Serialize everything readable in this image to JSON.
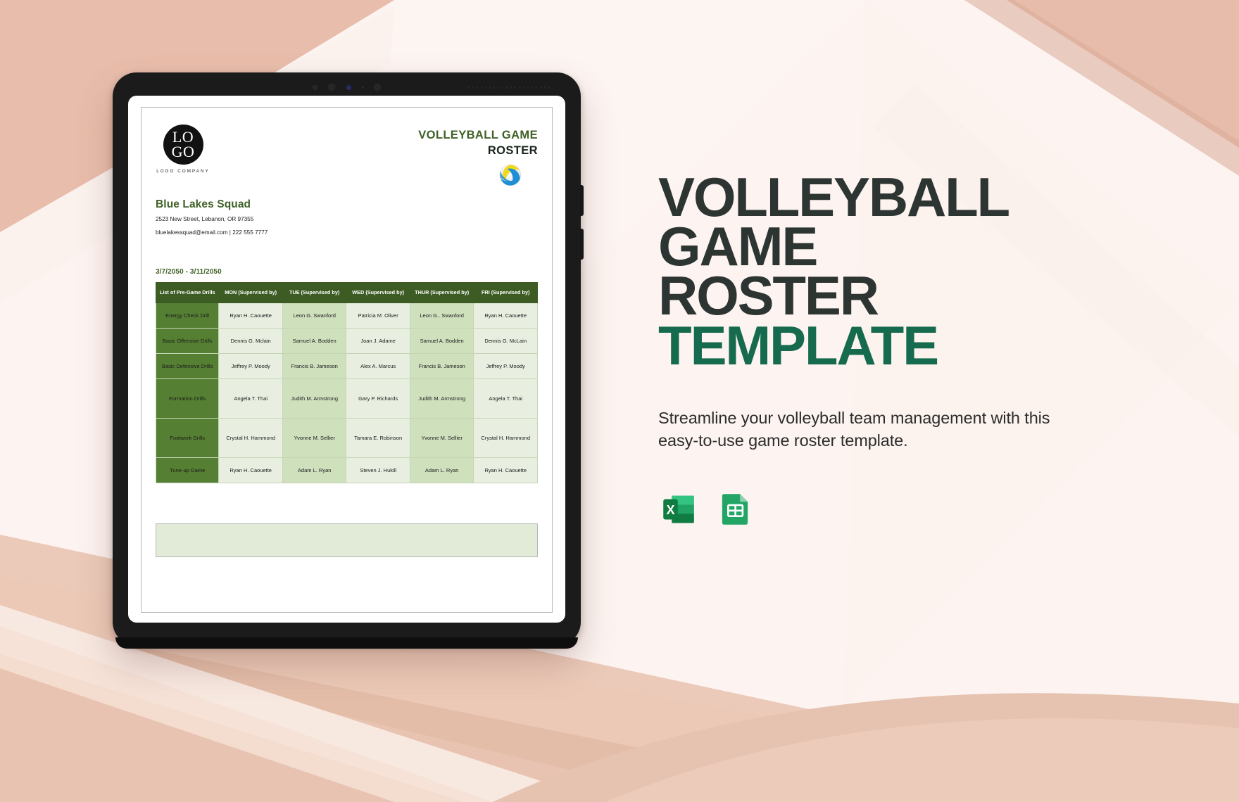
{
  "promo": {
    "title_line1": "VOLLEYBALL",
    "title_line2": "GAME",
    "title_line3": "ROSTER",
    "title_line4": "TEMPLATE",
    "subtitle": "Streamline your volleyball team management with this easy-to-use game roster template.",
    "file_formats": [
      {
        "name": "excel-icon",
        "label": "X"
      },
      {
        "name": "google-sheets-icon",
        "label": ""
      }
    ],
    "colors": {
      "heading_dark": "#2d3533",
      "heading_accent": "#166b4f"
    }
  },
  "document": {
    "logo": {
      "line1": "LO",
      "line2": "GO",
      "caption": "LOGO COMPANY"
    },
    "title_line1": "VOLLEYBALL GAME",
    "title_line2": "ROSTER",
    "ball_icon": "volleyball-icon",
    "team_name": "Blue Lakes Squad",
    "address": "2523 New Street, Lebanon, OR 97355",
    "contact": "bluelakessquad@email.com  |  222 555 7777",
    "date_range": "3/7/2050 - 3/11/2050",
    "colors": {
      "header_green": "#3d5c24",
      "drill_green": "#558033",
      "cell_light": "#e8efe0",
      "cell_dark": "#cfe0bd",
      "title_green": "#3f6127"
    },
    "table": {
      "columns": [
        "List of Pre-Game Drills",
        "MON (Supervised by)",
        "TUE (Supervised by)",
        "WED (Supervised by)",
        "THUR (Supervised by)",
        "FRI (Supervised by)"
      ],
      "rows": [
        {
          "drill": "Energy Check Drill",
          "mon": "Ryan H. Caouette",
          "tue": "Leon G. Swanford",
          "wed": "Patricia M. Oliver",
          "thur": "Leon G.. Swanford",
          "fri": "Ryan H. Caouette"
        },
        {
          "drill": "Basic Offensive Drills",
          "mon": "Dennis G. Mclain",
          "tue": "Samuel A. Bodden",
          "wed": "Joan J. Adame",
          "thur": "Samuel A. Bodden",
          "fri": "Dennis G. McLain"
        },
        {
          "drill": "Basic Defensive Drills",
          "mon": "Jeffrey P. Moody",
          "tue": "Francis B. Jameson",
          "wed": "Alex A. Marcus",
          "thur": "Francis B. Jameson",
          "fri": "Jeffrey P. Moody"
        },
        {
          "drill": "Formation Drills",
          "mon": "Angela T. Thai",
          "tue": "Judith M. Armstrong",
          "wed": "Gary P. Richards",
          "thur": "Judith M. Armstrong",
          "fri": "Angela T. Thai"
        },
        {
          "drill": "Footwork Drills",
          "mon": "Crystal H. Hammond",
          "tue": "Yvonne M. Sellier",
          "wed": "Tamara E. Robinson",
          "thur": "Yvonne M. Sellier",
          "fri": "Crystal H. Hammond"
        },
        {
          "drill": "Tune-up Game",
          "mon": "Ryan H. Caouette",
          "tue": "Adam L. Ryan",
          "wed": "Steven J. Hukill",
          "thur": "Adam L. Ryan",
          "fri": "Ryan H. Caouette"
        }
      ]
    }
  },
  "background": {
    "base": "#fdf4f1",
    "blush_dark": "#d9ac9b",
    "blush_mid": "#e8bfae",
    "blush_light": "#f3d8cb",
    "blush_pale": "#faeae3"
  }
}
